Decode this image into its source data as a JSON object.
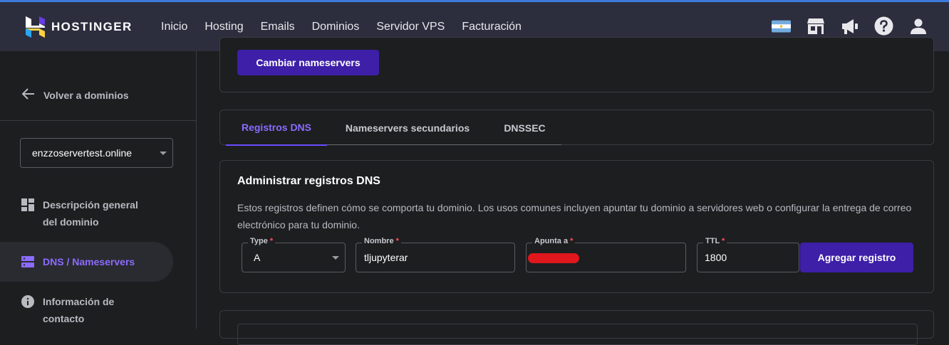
{
  "brand": {
    "name": "HOSTINGER"
  },
  "nav": {
    "items": [
      "Inicio",
      "Hosting",
      "Emails",
      "Dominios",
      "Servidor VPS",
      "Facturación"
    ]
  },
  "top_icons": [
    "argentina-flag-icon",
    "store-icon",
    "megaphone-icon",
    "help-icon",
    "user-icon"
  ],
  "sidebar": {
    "back_label": "Volver a dominios",
    "domain": "enzzoservertest.online",
    "items": [
      {
        "label": "Descripción general del dominio",
        "icon": "grid-icon",
        "active": false
      },
      {
        "label": "DNS / Nameservers",
        "icon": "server-icon",
        "active": true
      },
      {
        "label": "Información de contacto",
        "icon": "info-icon",
        "active": false
      }
    ]
  },
  "nameservers_card": {
    "button_label": "Cambiar nameservers"
  },
  "tabs": [
    {
      "label": "Registros DNS",
      "active": true
    },
    {
      "label": "Nameservers secundarios",
      "active": false
    },
    {
      "label": "DNSSEC",
      "active": false
    }
  ],
  "dns": {
    "title": "Administrar registros DNS",
    "description": "Estos registros definen cómo se comporta tu dominio. Los usos comunes incluyen apuntar tu dominio a servidores web o configurar la entrega de correo electrónico para tu dominio.",
    "fields": {
      "type": {
        "label": "Type",
        "value": "A"
      },
      "name": {
        "label": "Nombre",
        "value": "tljupyterar"
      },
      "points_to": {
        "label": "Apunta a",
        "value": ""
      },
      "ttl": {
        "label": "TTL",
        "value": "1800"
      }
    },
    "add_button": "Agregar registro"
  },
  "colors": {
    "accent": "#673de6",
    "primary_button": "#3d1fa8",
    "required": "#ff4d5e"
  }
}
